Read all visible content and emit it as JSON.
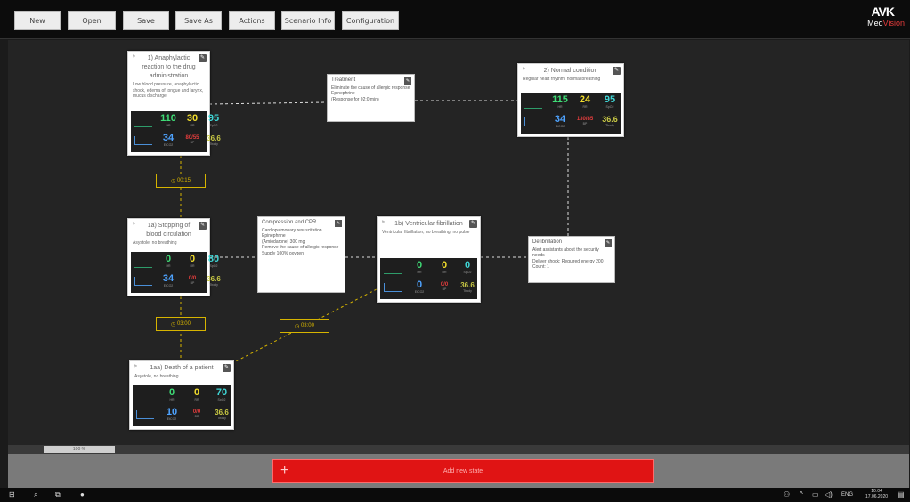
{
  "toolbar": {
    "buttons": [
      "New",
      "Open",
      "Save",
      "Save As",
      "Actions",
      "Scenario Info",
      "Configuration"
    ]
  },
  "brand": {
    "mark": "AVK",
    "name_a": "Med",
    "name_b": "Vision"
  },
  "nodes": {
    "n1": {
      "title": "1) Anaphylactic reaction to the drug administration",
      "desc": "Low blood pressure, anaphylactic shock, edema of tongue and larynx, mucus discharge",
      "hr": "110",
      "rr": "30",
      "spo2": "95",
      "etco2": "34",
      "bp": "80/55",
      "temp": "36.6"
    },
    "n2": {
      "title": "2) Normal condition",
      "desc": "Regular heart rhythm, normal breathing",
      "hr": "115",
      "rr": "24",
      "spo2": "95",
      "etco2": "34",
      "bp": "130/85",
      "temp": "36.6"
    },
    "n1a": {
      "title": "1a) Stopping of blood circulation",
      "desc": "Asystole, no breathing",
      "hr": "0",
      "rr": "0",
      "spo2": "80",
      "etco2": "34",
      "bp": "0/0",
      "temp": "36.6"
    },
    "n1b": {
      "title": "1b) Ventricular fibrillation",
      "desc": "Ventricular fibrillation, no breathing, no pulse",
      "hr": "0",
      "rr": "0",
      "spo2": "0",
      "etco2": "0",
      "bp": "0/0",
      "temp": "36.6"
    },
    "n1aa": {
      "title": "1aa) Death of a patient",
      "desc": "Asystole, no breathing",
      "hr": "0",
      "rr": "0",
      "spo2": "70",
      "etco2": "10",
      "bp": "0/0",
      "temp": "36.6"
    }
  },
  "vital_labels": {
    "hr": "HR",
    "rr": "RR",
    "spo2": "SpO2",
    "etco2": "EtCO2",
    "bp": "BP",
    "temp": "Tbody"
  },
  "annotations": {
    "treatment": {
      "title": "Treatment",
      "lines": [
        "Eliminate the cause of allergic response",
        "Epinephrine",
        "(Response for 02:0 min)"
      ]
    },
    "cpr": {
      "title": "Compression and CPR",
      "lines": [
        "Cardiopulmonary resuscitation",
        "Epinephrine",
        "(Amiodarone) 300 mg",
        "Remove the cause of allergic response",
        "Supply 100% oxygen"
      ]
    },
    "defib": {
      "title": "Defibrillation",
      "lines": [
        "Alert assistants about the security needs",
        "Deliver shock: Required energy 200 Count: 1"
      ]
    }
  },
  "timers": {
    "t1": "00:15",
    "t2": "03:00",
    "t3": "03:00"
  },
  "zoom": "100 %",
  "add_new": "Add new state",
  "taskbar": {
    "lang": "ENG",
    "time": "10:04",
    "date": "17.06.2020"
  }
}
